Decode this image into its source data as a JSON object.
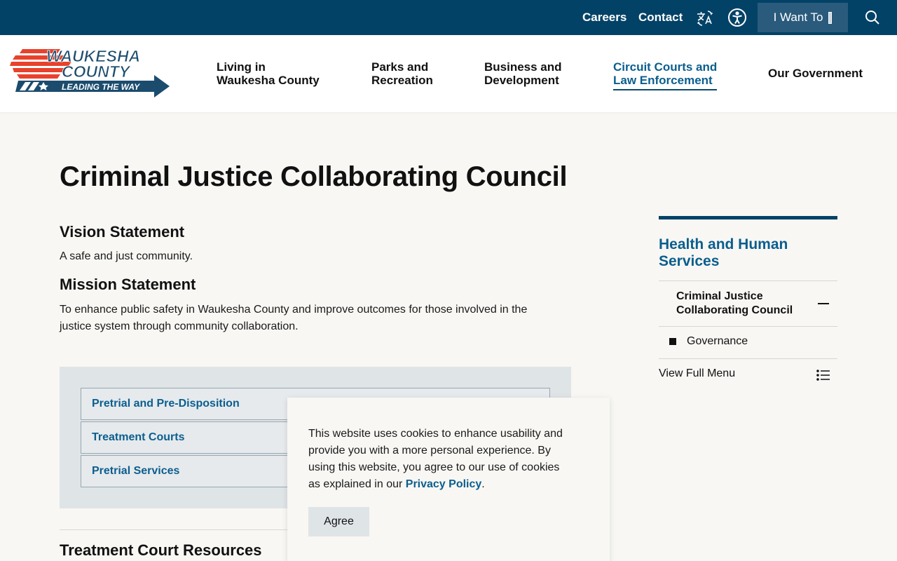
{
  "utility": {
    "careers": "Careers",
    "contact": "Contact",
    "i_want_to": "I Want To",
    "icons": [
      "translate-icon",
      "accessibility-icon",
      "search-icon"
    ]
  },
  "logo": {
    "line1": "WAUKESHA",
    "line2": "COUNTY",
    "tagline": "LEADING THE WAY"
  },
  "nav": [
    {
      "line1": "Living in",
      "line2": "Waukesha County"
    },
    {
      "line1": "Parks and",
      "line2": "Recreation"
    },
    {
      "line1": "Business and",
      "line2": "Development"
    },
    {
      "line1": "Circuit Courts and",
      "line2": "Law Enforcement"
    },
    {
      "line1": "Our Government",
      "line2": ""
    }
  ],
  "main": {
    "title": "Criminal Justice Collaborating Council",
    "vision_heading": "Vision Statement",
    "vision_text": "A safe and just community.",
    "mission_heading": "Mission Statement",
    "mission_text_1": "To enhance public safety in Waukesha County and improve outcomes for those involved in the",
    "mission_text_2": "justice system through community collaboration.",
    "accordion": [
      "Pretrial and Pre-Disposition",
      "Treatment Courts",
      "Pretrial Services"
    ],
    "resources_heading": "Treatment Court Resources"
  },
  "sidebar": {
    "heading_1": "Health and Human",
    "heading_2": "Services",
    "current_1": "Criminal Justice",
    "current_2": "Collaborating Council",
    "sub_item": "Governance",
    "view_full": "View Full Menu"
  },
  "cookie": {
    "text_1": "This website uses cookies to enhance usability and",
    "text_2": "provide you with a more personal experience. By",
    "text_3": "using this website, you agree to our use of cookies",
    "text_4": "as explained in our ",
    "link": "Privacy Policy",
    "period": ".",
    "agree": "Agree"
  },
  "colors": {
    "utility_bg": "#034267",
    "link": "#0b5e8e",
    "page_bg": "#f8f7f4",
    "accordion_bg": "#dfe4e7",
    "logo_red": "#e8412c"
  }
}
